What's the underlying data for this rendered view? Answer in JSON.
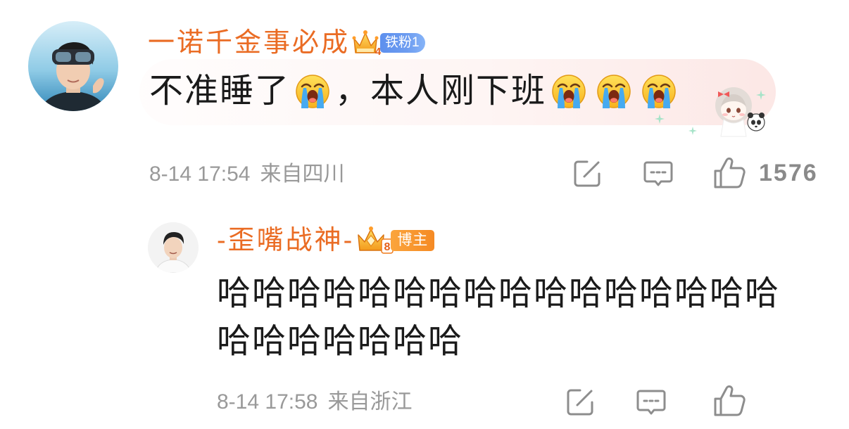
{
  "comment": {
    "user": {
      "name": "一诺千金事必成",
      "crown_level": "4",
      "fan_badge": "铁粉1"
    },
    "text_parts": [
      "不准睡了",
      "，本人刚下班"
    ],
    "time": "8-14 17:54",
    "location": "来自四川",
    "likes": "1576"
  },
  "reply": {
    "user": {
      "name": "-歪嘴战神-",
      "crown_level": "8",
      "role_badge": "博主"
    },
    "text": "哈哈哈哈哈哈哈哈哈哈哈哈哈哈哈哈哈哈哈哈哈哈哈",
    "time": "8-14 17:58",
    "location": "来自浙江"
  },
  "icons": {
    "share": "share-icon",
    "comment": "comment-icon",
    "like": "thumbs-up-icon",
    "crown": "crown-badge-icon",
    "emoji": "crying-emoji-icon",
    "sparkle": "sparkle-icon"
  },
  "colors": {
    "username": "#ea6c24",
    "text": "#1a1a1a",
    "meta": "#999999",
    "icon": "#8d8d8d",
    "fan_badge": "#6d9cf0",
    "role_badge": "#f58a24"
  }
}
